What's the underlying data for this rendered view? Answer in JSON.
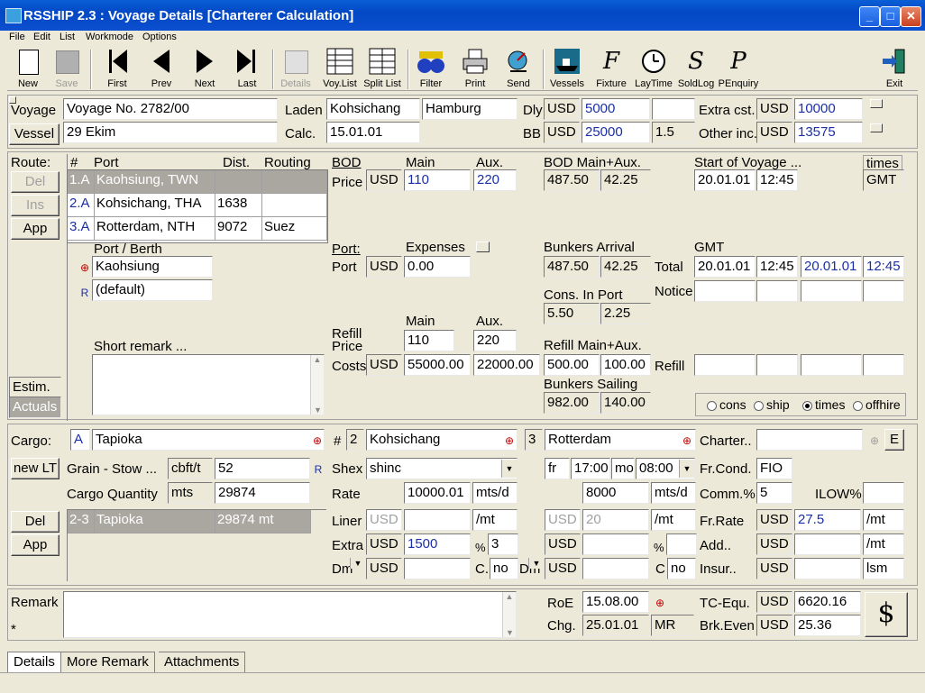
{
  "window": {
    "title": "RSSHIP 2.3 : Voyage Details  [Charterer Calculation]"
  },
  "menu": [
    "File",
    "Edit",
    "List",
    "Workmode",
    "Options"
  ],
  "toolbar": [
    {
      "label": "New",
      "enabled": true
    },
    {
      "label": "Save",
      "enabled": false
    },
    {
      "label": "First",
      "enabled": true
    },
    {
      "label": "Prev",
      "enabled": true
    },
    {
      "label": "Next",
      "enabled": true
    },
    {
      "label": "Last",
      "enabled": true
    },
    {
      "label": "Details",
      "enabled": false
    },
    {
      "label": "Voy.List",
      "enabled": true
    },
    {
      "label": "Split List",
      "enabled": true
    },
    {
      "label": "Filter",
      "enabled": true
    },
    {
      "label": "Print",
      "enabled": true
    },
    {
      "label": "Send",
      "enabled": true
    },
    {
      "label": "Vessels",
      "enabled": true
    },
    {
      "label": "Fixture",
      "enabled": true
    },
    {
      "label": "LayTime",
      "enabled": true
    },
    {
      "label": "SoldLog",
      "enabled": true
    },
    {
      "label": "PEnquiry",
      "enabled": true
    },
    {
      "label": "Exit",
      "enabled": true
    }
  ],
  "header": {
    "voyage_label": "Voyage",
    "voyage_value": "Voyage No. 2782/00",
    "vessel_button": "Vessel",
    "vessel_value": "29 Ekim",
    "laden_label": "Laden",
    "laden_from": "Kohsichang",
    "laden_to": "Hamburg",
    "calc_label": "Calc.",
    "calc_value": "15.01.01",
    "dly_label": "Dly",
    "dly_cur": "USD",
    "dly_value": "5000",
    "dly_extra": "",
    "bb_label": "BB",
    "bb_cur": "USD",
    "bb_value": "25000",
    "bb_extra": "1.5",
    "extra_cst_label": "Extra cst.",
    "extra_cst_cur": "USD",
    "extra_cst_value": "10000",
    "other_inc_label": "Other inc.",
    "other_inc_cur": "USD",
    "other_inc_value": "13575"
  },
  "route": {
    "label": "Route:",
    "del_button": "Del",
    "ins_button": "Ins",
    "app_button": "App",
    "columns": [
      "#",
      "Port",
      "Dist.",
      "Routing"
    ],
    "rows": [
      {
        "num": "1.",
        "flag": "A",
        "port": "Kaohsiung, TWN",
        "dist": "",
        "routing": ""
      },
      {
        "num": "2.",
        "flag": "A",
        "port": "Kohsichang, THA",
        "dist": "1638",
        "routing": ""
      },
      {
        "num": "3.",
        "flag": "A",
        "port": "Rotterdam, NTH",
        "dist": "9072",
        "routing": "Suez"
      }
    ],
    "port_berth_label": "Port / Berth",
    "port_value": "Kaohsiung",
    "berth_value": "(default)",
    "short_remark_label": "Short remark ...",
    "short_remark_value": "",
    "estim_label": "Estim.",
    "actuals_label": "Actuals"
  },
  "bod": {
    "bod_label": "BOD",
    "price_label": "Price",
    "main_label": "Main",
    "aux_label": "Aux.",
    "currency": "USD",
    "main_value": "110",
    "aux_value": "220",
    "bod_main_aux_label": "BOD Main+Aux.",
    "bod_main": "487.50",
    "bod_aux": "42.25",
    "start_voyage_label": "Start of Voyage ...",
    "times_label": "times",
    "start_date": "20.01.01",
    "start_time": "12:45",
    "start_tz": "GMT"
  },
  "port_section": {
    "port_header": "Port:",
    "port_label": "Port",
    "expenses_label": "Expenses",
    "currency": "USD",
    "expenses_value": "0.00",
    "bunkers_arrival_label": "Bunkers Arrival",
    "arr_main": "487.50",
    "arr_aux": "42.25",
    "gmt_label": "GMT",
    "total_label": "Total",
    "total_date": "20.01.01",
    "total_time": "12:45",
    "total_date2": "20.01.01",
    "total_time2": "12:45",
    "notice_label": "Notice",
    "cons_in_port_label": "Cons. In Port",
    "cons_main": "5.50",
    "cons_aux": "2.25"
  },
  "refill": {
    "main_label": "Main",
    "aux_label": "Aux.",
    "refill_price_label": "Refill Price",
    "costs_label": "Costs",
    "main_price": "110",
    "aux_price": "220",
    "currency": "USD",
    "main_cost": "55000.00",
    "aux_cost": "22000.00",
    "refill_main_aux_label": "Refill Main+Aux.",
    "refill_main": "500.00",
    "refill_aux": "100.00",
    "refill_label": "Refill",
    "bunkers_sailing_label": "Bunkers Sailing",
    "sail_main": "982.00",
    "sail_aux": "140.00"
  },
  "mode_radios": [
    {
      "label": "cons",
      "checked": false
    },
    {
      "label": "ship",
      "checked": false
    },
    {
      "label": "times",
      "checked": true
    },
    {
      "label": "offhire",
      "checked": false
    }
  ],
  "cargo": {
    "label": "Cargo:",
    "flag": "A",
    "name": "Tapioka",
    "new_lt_button": "new LT",
    "grain_label": "Grain - Stow ...",
    "grain_unit": "cbft/t",
    "grain_value": "52",
    "qty_label": "Cargo Quantity",
    "qty_unit": "mts",
    "qty_value": "29874",
    "del_button": "Del",
    "app_button": "App",
    "list_item": {
      "range": "2-3",
      "name": "Tapioka",
      "qty": "29874 mt"
    },
    "hash": "#",
    "load_num": "2",
    "load_port": "Kohsichang",
    "disch_num": "3",
    "disch_port": "Rotterdam",
    "shex_label": "Shex",
    "shex_value": "shinc",
    "rate_label": "Rate",
    "rate_value": "10000.01",
    "rate_unit": "mts/d",
    "fr_value": "fr",
    "fr_time": "17:00",
    "mo_value": "mo",
    "mo_time": "08:00",
    "disch_rate": "8000",
    "disch_rate_unit": "mts/d",
    "liner_label": "Liner",
    "liner_cur": "USD",
    "liner_unit": "/mt",
    "liner2_cur": "USD",
    "liner2_value": "20",
    "liner2_unit": "/mt",
    "extra_label": "Extra",
    "extra_cur": "USD",
    "extra_value": "1500",
    "extra_pct": "3",
    "extra2_cur": "USD",
    "pct_sign": "%",
    "dm_label": "Dm",
    "dm_cur": "USD",
    "c_label": "C.",
    "c_value": "no",
    "dm2_label": "Dm",
    "dm2_cur": "USD",
    "c2_label": "C",
    "c2_value": "no"
  },
  "charter": {
    "charter_label": "Charter..",
    "charter_value": "",
    "e_button": "E",
    "frcond_label": "Fr.Cond.",
    "frcond_value": "FIO",
    "comm_label": "Comm.%",
    "comm_value": "5",
    "ilow_label": "ILOW%",
    "ilow_value": "",
    "frrate_label": "Fr.Rate",
    "frrate_cur": "USD",
    "frrate_value": "27.5",
    "frrate_unit": "/mt",
    "add_label": "Add..",
    "add_cur": "USD",
    "add_unit": "/mt",
    "insur_label": "Insur..",
    "insur_cur": "USD",
    "insur_unit": "lsm"
  },
  "bottom": {
    "remark_label": "Remark",
    "remark_star": "*",
    "remark_value": "",
    "roe_label": "RoE",
    "roe_value": "15.08.00",
    "chg_label": "Chg.",
    "chg_value": "25.01.01",
    "chg_by": "MR",
    "tc_label": "TC-Equ.",
    "tc_cur": "USD",
    "tc_value": "6620.16",
    "brk_label": "Brk.Even",
    "brk_cur": "USD",
    "brk_value": "25.36"
  },
  "tabs": [
    "Details",
    "More Remark",
    "Attachments"
  ]
}
